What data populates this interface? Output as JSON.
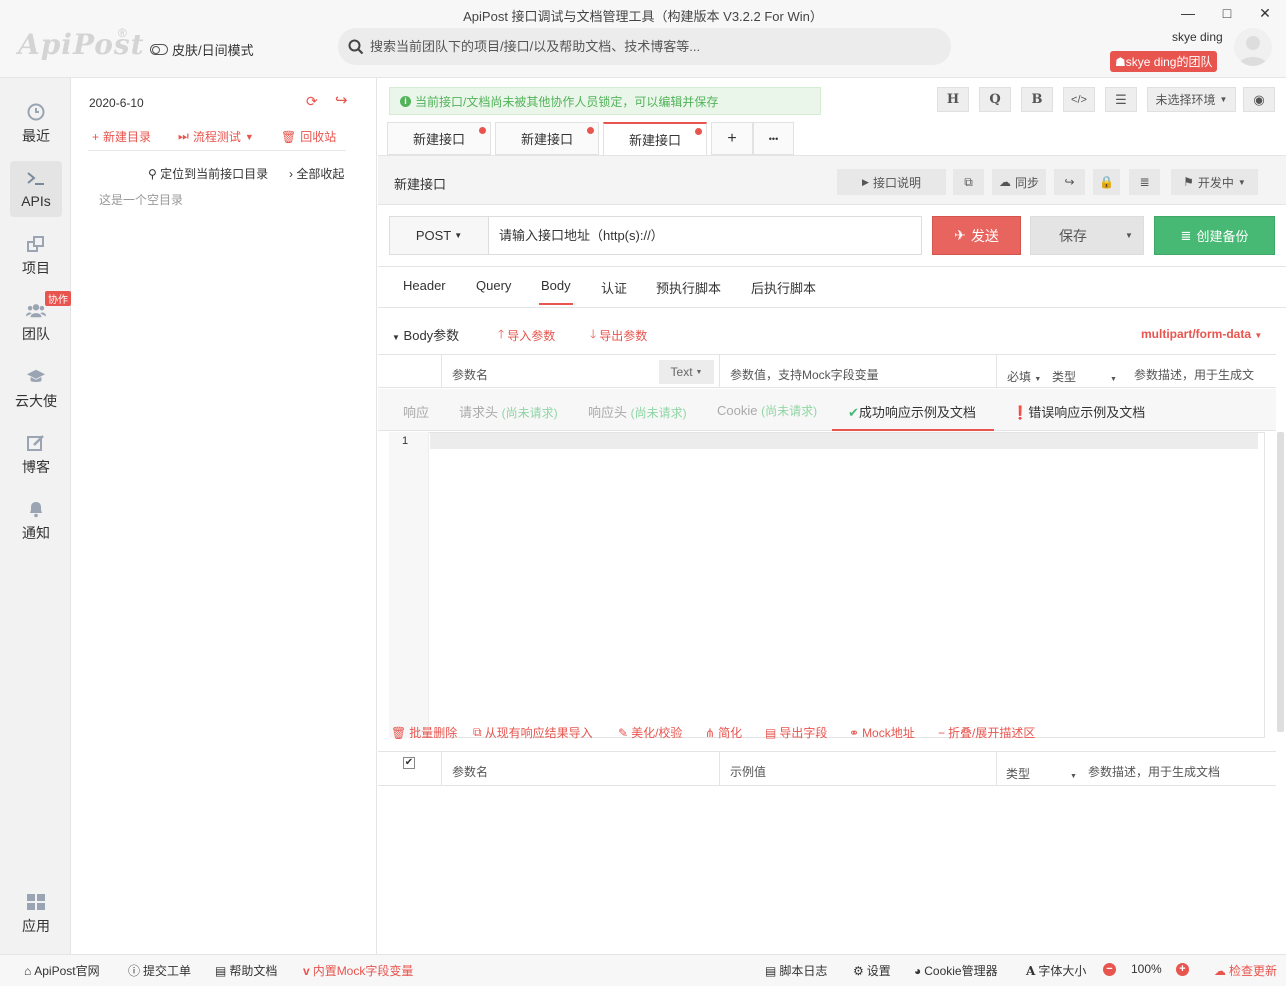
{
  "window": {
    "title": "ApiPost 接口调试与文档管理工具（构建版本 V3.2.2 For Win）",
    "minimize": "—",
    "maximize": "□",
    "close": "✕"
  },
  "header": {
    "logo": "ApiPost",
    "logo_mark": "®",
    "skin_toggle": "皮肤/日间模式",
    "search_placeholder": "搜索当前团队下的项目/接口/以及帮助文档、技术博客等...",
    "username": "skye ding",
    "team": "skye ding的团队"
  },
  "leftnav": {
    "items": [
      {
        "label": "最近",
        "icon": "clock-icon"
      },
      {
        "label": "APIs",
        "icon": "terminal-icon"
      },
      {
        "label": "项目",
        "icon": "project-icon"
      },
      {
        "label": "团队",
        "icon": "team-icon"
      },
      {
        "label": "云大使",
        "icon": "graduation-cap-icon"
      },
      {
        "label": "博客",
        "icon": "edit-icon"
      },
      {
        "label": "通知",
        "icon": "bell-icon"
      },
      {
        "label": "应用",
        "icon": "apps-grid-icon"
      }
    ],
    "collab_badge": "协作"
  },
  "tree": {
    "date": "2020-6-10",
    "new_dir": "新建目录",
    "flow_test": "流程测试",
    "recycle": "回收站",
    "locate": "定位到当前接口目录",
    "collapse_all": "全部收起",
    "empty": "这是一个空目录"
  },
  "toolbar": {
    "lock_notice": "当前接口/文档尚未被其他协作人员锁定，可以编辑并保存",
    "btn_h": "H",
    "btn_q": "Q",
    "btn_b": "B",
    "env": "未选择环境"
  },
  "tabs": [
    {
      "label": "新建接口"
    },
    {
      "label": "新建接口"
    },
    {
      "label": "新建接口"
    }
  ],
  "tab_add": "+",
  "tab_more": "•••",
  "api": {
    "name": "新建接口",
    "doc_btn": "接口说明",
    "sync_btn": "同步",
    "status": "开发中",
    "method": "POST",
    "url_placeholder": "请输入接口地址（http(s)://）",
    "send": "发送",
    "save": "保存",
    "backup": "创建备份"
  },
  "request_tabs": [
    "Header",
    "Query",
    "Body",
    "认证",
    "预执行脚本",
    "后执行脚本"
  ],
  "body": {
    "label": "Body参数",
    "import": "导入参数",
    "export": "导出参数",
    "content_type": "multipart/form-data",
    "col_name": "参数名",
    "col_type_select": "Text",
    "col_value": "参数值，支持Mock字段变量",
    "col_required": "必填",
    "col_type": "类型",
    "col_desc": "参数描述，用于生成文"
  },
  "response_tabs": {
    "resp": "响应",
    "req_headers": "请求头",
    "resp_headers": "响应头",
    "cookie": "Cookie",
    "not_requested": "(尚未请求)",
    "success": "成功响应示例及文档",
    "error": "错误响应示例及文档"
  },
  "editor": {
    "line": "1"
  },
  "resp_tools": {
    "batch_delete": "批量删除",
    "import_existing": "从现有响应结果导入",
    "beautify": "美化/校验",
    "simplify": "简化",
    "export_fields": "导出字段",
    "mock_url": "Mock地址",
    "fold": "折叠/展开描述区"
  },
  "resp_table": {
    "col_name": "参数名",
    "col_example": "示例值",
    "col_type": "类型",
    "col_desc": "参数描述，用于生成文档"
  },
  "footer": {
    "official": "ApiPost官网",
    "ticket": "提交工单",
    "help": "帮助文档",
    "mock_vars": "内置Mock字段变量",
    "script_log": "脚本日志",
    "settings": "设置",
    "cookie_mgr": "Cookie管理器",
    "font_size": "字体大小",
    "zoom": "100%",
    "check_update": "检查更新"
  },
  "colors": {
    "accent": "#e8544e",
    "success": "#48b974",
    "send": "#e8645e"
  }
}
